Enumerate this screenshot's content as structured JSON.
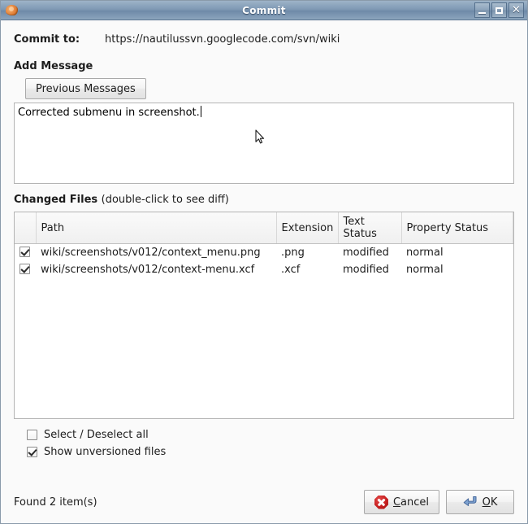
{
  "window": {
    "title": "Commit",
    "icon": "nautilus-shell-icon",
    "controls": [
      {
        "name": "minimize-button",
        "glyph": "_"
      },
      {
        "name": "maximize-button",
        "glyph": "□"
      },
      {
        "name": "close-button",
        "glyph": "✕"
      }
    ]
  },
  "commit_to": {
    "label": "Commit to:",
    "url": "https://nautilussvn.googlecode.com/svn/wiki"
  },
  "add_message": {
    "section_title": "Add Message",
    "previous_messages_label": "Previous Messages",
    "message_text": "Corrected submenu in screenshot."
  },
  "changed_files": {
    "section_title": "Changed Files",
    "section_hint": "(double-click to see diff)",
    "columns": [
      "",
      "Path",
      "Extension",
      "Text Status",
      "Property Status"
    ],
    "rows": [
      {
        "checked": true,
        "path": "wiki/screenshots/v012/context_menu.png",
        "extension": ".png",
        "text_status": "modified",
        "property_status": "normal"
      },
      {
        "checked": true,
        "path": "wiki/screenshots/v012/context-menu.xcf",
        "extension": ".xcf",
        "text_status": "modified",
        "property_status": "normal"
      }
    ]
  },
  "options": [
    {
      "label": "Select / Deselect all",
      "checked": false
    },
    {
      "label": "Show unversioned files",
      "checked": true
    }
  ],
  "footer": {
    "status": "Found 2 item(s)",
    "cancel_label_mnemonic": "C",
    "cancel_label_rest": "ancel",
    "ok_label_mnemonic": "O",
    "ok_label_rest": "K"
  },
  "colors": {
    "titlebar_top": "#9db3c8",
    "titlebar_bottom": "#8ca5bd",
    "dialog_bg": "#fafafa",
    "cancel_icon": "#c61f1f",
    "ok_icon": "#6a8fc4",
    "text": "#1d1d1d"
  }
}
